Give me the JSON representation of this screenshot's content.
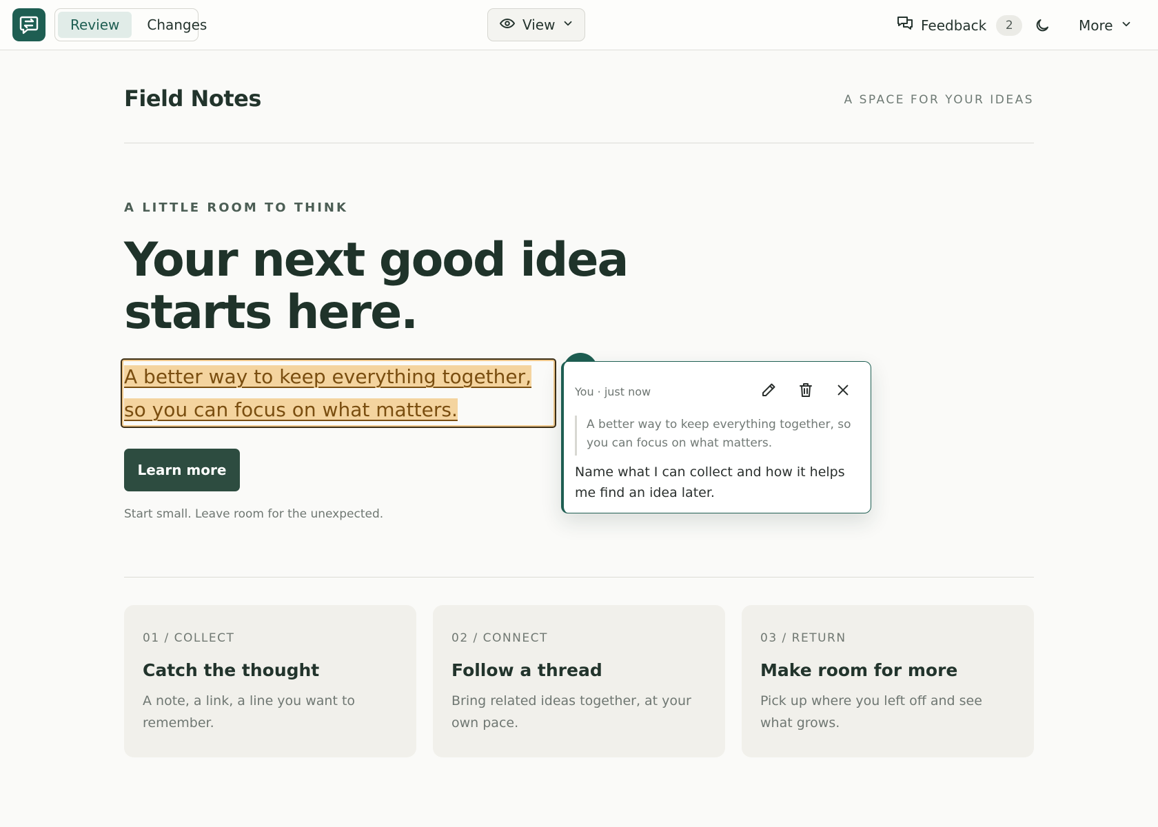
{
  "toolbar": {
    "tabs": [
      {
        "label": "Review",
        "active": true
      },
      {
        "label": "Changes",
        "active": false
      }
    ],
    "view_label": "View",
    "feedback_label": "Feedback",
    "feedback_count": "2",
    "more_label": "More",
    "icons": {
      "logo": "swap-chat-icon",
      "view": "eye-icon",
      "feedback": "chat-bubbles-icon",
      "theme": "moon-icon",
      "dropdown": "chevron-down-icon"
    }
  },
  "site": {
    "brand": "Field Notes",
    "tagline": "A SPACE FOR YOUR IDEAS"
  },
  "hero": {
    "eyebrow": "A LITTLE ROOM TO THINK",
    "headline": "Your next good idea starts here.",
    "subline": "A better way to keep everything together, so you can focus on what matters.",
    "cta_label": "Learn more",
    "helper": "Start small. Leave room for the unexpected."
  },
  "comment": {
    "meta": "You · just now",
    "quote": "A better way to keep everything together, so you can focus on what matters.",
    "body": "Name what I can collect and how it helps me find an idea later.",
    "icons": {
      "edit": "pencil-icon",
      "delete": "trash-icon",
      "close": "close-icon"
    }
  },
  "cards": [
    {
      "kicker": "01 / COLLECT",
      "title": "Catch the thought",
      "text": "A note, a link, a line you want to remember."
    },
    {
      "kicker": "02 / CONNECT",
      "title": "Follow a thread",
      "text": "Bring related ideas together, at your own pace."
    },
    {
      "kicker": "03 / RETURN",
      "title": "Make room for more",
      "text": "Pick up where you left off and see what grows."
    }
  ],
  "colors": {
    "accent": "#1e5e52",
    "cta": "#2d4c40",
    "highlight": "#f4d49f",
    "background": "#fafaf8"
  }
}
